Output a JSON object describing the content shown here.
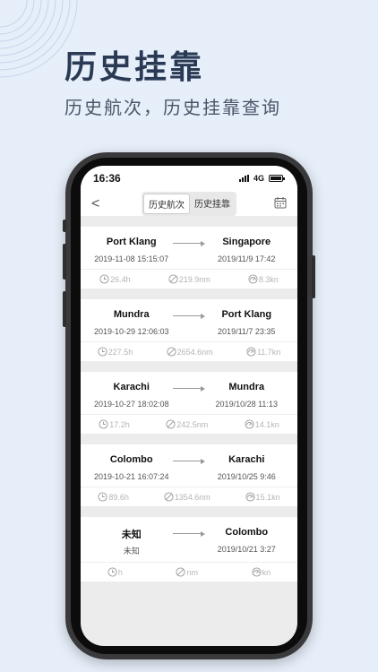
{
  "hero": {
    "title": "历史挂靠",
    "subtitle": "历史航次，历史挂靠查询"
  },
  "status_bar": {
    "time": "16:36",
    "network": "4G"
  },
  "nav": {
    "back_glyph": "<",
    "tabs": [
      {
        "label": "历史航次",
        "active": true
      },
      {
        "label": "历史挂靠",
        "active": false
      }
    ],
    "calendar_icon": "calendar-icon"
  },
  "voyages": [
    {
      "from": "Port Klang",
      "from_time": "2019-11-08 15:15:07",
      "to": "Singapore",
      "to_time": "2019/11/9 17:42",
      "duration": "26.4h",
      "distance": "219.9nm",
      "speed": "8.3kn"
    },
    {
      "from": "Mundra",
      "from_time": "2019-10-29 12:06:03",
      "to": "Port Klang",
      "to_time": "2019/11/7 23:35",
      "duration": "227.5h",
      "distance": "2654.6nm",
      "speed": "11.7kn"
    },
    {
      "from": "Karachi",
      "from_time": "2019-10-27 18:02:08",
      "to": "Mundra",
      "to_time": "2019/10/28 11:13",
      "duration": "17.2h",
      "distance": "242.5nm",
      "speed": "14.1kn"
    },
    {
      "from": "Colombo",
      "from_time": "2019-10-21 16:07:24",
      "to": "Karachi",
      "to_time": "2019/10/25 9:46",
      "duration": "89.6h",
      "distance": "1354.6nm",
      "speed": "15.1kn"
    },
    {
      "from": "未知",
      "from_time": "未知",
      "to": "Colombo",
      "to_time": "2019/10/21 3:27",
      "duration": "h",
      "distance": "nm",
      "speed": "kn"
    }
  ],
  "colors": {
    "background": "#e6eef9",
    "title": "#2a3a55",
    "stat_text": "#b5b5b5"
  }
}
